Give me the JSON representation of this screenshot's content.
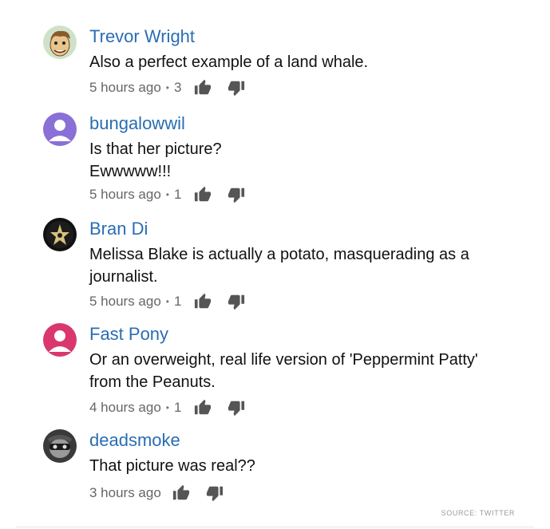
{
  "comments": [
    {
      "author": "Trevor Wright",
      "avatar": "cartoon-face-avatar",
      "text": "Also a perfect example of a land whale.",
      "time": "5 hours ago",
      "likes": "3"
    },
    {
      "author": "bungalowwil",
      "avatar": "default-user-avatar-purple",
      "text": "Is that her picture?\nEwwwww!!!",
      "time": "5 hours ago",
      "likes": "1"
    },
    {
      "author": "Bran Di",
      "avatar": "dark-emblem-avatar",
      "text": "Melissa Blake is actually a potato, masquerading as a journalist.",
      "time": "5 hours ago",
      "likes": "1"
    },
    {
      "author": "Fast Pony",
      "avatar": "default-user-avatar-pink",
      "text": "Or an overweight, real life version of 'Peppermint Patty' from the Peanuts.",
      "time": "4 hours ago",
      "likes": "1"
    },
    {
      "author": "deadsmoke",
      "avatar": "photo-avatar",
      "text": "That picture was real??",
      "time": "3 hours ago",
      "likes": ""
    }
  ],
  "icons": {
    "like": "thumbs-up-icon",
    "dislike": "thumbs-down-icon"
  },
  "colors": {
    "author": "#2a6db3",
    "text": "#111111",
    "meta": "#666666",
    "avatar_purple": "#8a6fd6",
    "avatar_pink": "#d9376e"
  },
  "footer": {
    "source": "SOURCE: TWITTER"
  }
}
